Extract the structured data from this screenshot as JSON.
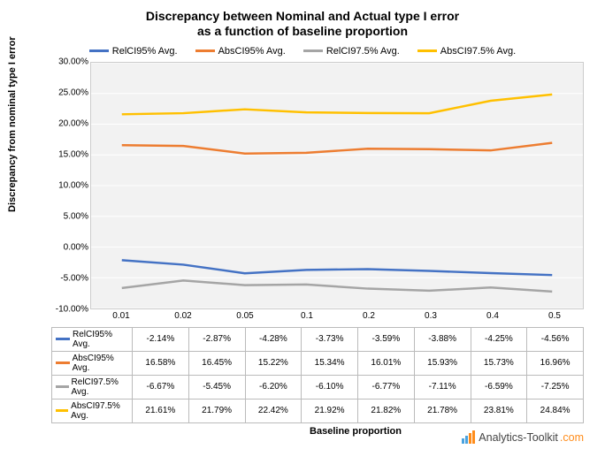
{
  "chart_data": {
    "type": "line",
    "title_line1": "Discrepancy between Nominal and Actual type I error",
    "title_line2": "as a function of baseline proportion",
    "xlabel": "Baseline proportion",
    "ylabel": "Discrepancy from nominal type I error",
    "categories": [
      "0.01",
      "0.02",
      "0.05",
      "0.1",
      "0.2",
      "0.3",
      "0.4",
      "0.5"
    ],
    "ylim": [
      -10,
      30
    ],
    "yticks": [
      "-10.00%",
      "-5.00%",
      "0.00%",
      "5.00%",
      "10.00%",
      "15.00%",
      "20.00%",
      "25.00%",
      "30.00%"
    ],
    "series": [
      {
        "name": "RelCI95% Avg.",
        "color": "#4472c4",
        "values": [
          -2.14,
          -2.87,
          -4.28,
          -3.73,
          -3.59,
          -3.88,
          -4.25,
          -4.56
        ],
        "labels": [
          "-2.14%",
          "-2.87%",
          "-4.28%",
          "-3.73%",
          "-3.59%",
          "-3.88%",
          "-4.25%",
          "-4.56%"
        ]
      },
      {
        "name": "AbsCI95% Avg.",
        "color": "#ed7d31",
        "values": [
          16.58,
          16.45,
          15.22,
          15.34,
          16.01,
          15.93,
          15.73,
          16.96
        ],
        "labels": [
          "16.58%",
          "16.45%",
          "15.22%",
          "15.34%",
          "16.01%",
          "15.93%",
          "15.73%",
          "16.96%"
        ]
      },
      {
        "name": "RelCI97.5% Avg.",
        "color": "#a5a5a5",
        "values": [
          -6.67,
          -5.45,
          -6.2,
          -6.1,
          -6.77,
          -7.11,
          -6.59,
          -7.25
        ],
        "labels": [
          "-6.67%",
          "-5.45%",
          "-6.20%",
          "-6.10%",
          "-6.77%",
          "-7.11%",
          "-6.59%",
          "-7.25%"
        ]
      },
      {
        "name": "AbsCI97.5% Avg.",
        "color": "#ffc000",
        "values": [
          21.61,
          21.79,
          22.42,
          21.92,
          21.82,
          21.78,
          23.81,
          24.84
        ],
        "labels": [
          "21.61%",
          "21.79%",
          "22.42%",
          "21.92%",
          "21.82%",
          "21.78%",
          "23.81%",
          "24.84%"
        ]
      }
    ]
  },
  "logo": {
    "brand": "Analytics-Toolkit",
    "tld": ".com"
  }
}
